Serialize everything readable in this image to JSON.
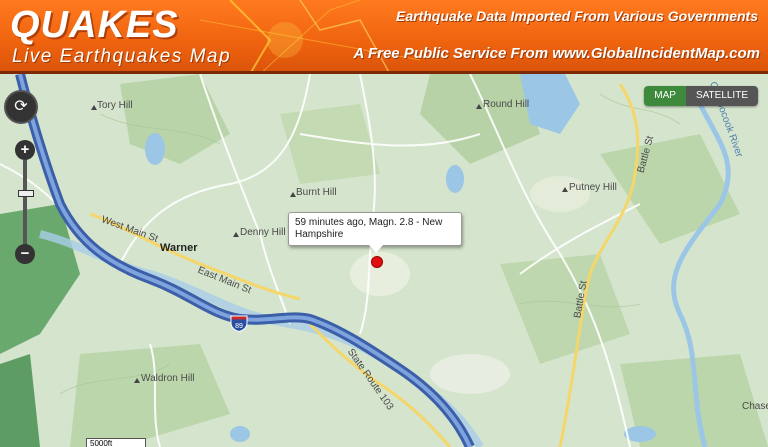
{
  "header": {
    "brand": "QUAKES",
    "subbrand": "Live Earthquakes Map",
    "tagline_top": "Earthquake Data Imported From Various Governments",
    "tagline_bottom": "A Free Public Service From www.GlobalIncidentMap.com"
  },
  "map_toggle": {
    "map_label": "MAP",
    "satellite_label": "SATELLITE",
    "active": "MAP"
  },
  "nav": {
    "zoom_in": "+",
    "zoom_out": "−",
    "pan_symbol": "⟳",
    "north_label": "N"
  },
  "popup": {
    "text": "59 minutes ago, Magn. 2.8 - New Hampshire"
  },
  "labels": {
    "tory_hill": "Tory Hill",
    "round_hill": "Round Hill",
    "burnt_hill": "Burnt Hill",
    "denny_hill": "Denny Hill",
    "warner": "Warner",
    "west_main_st": "West Main St",
    "east_main_st": "East Main St",
    "putney_hill": "Putney Hill",
    "waldron_hill": "Waldron Hill",
    "state_route": "State Route 103",
    "battle_st_upper": "Battle St",
    "battle_st_lower": "Battle St",
    "contoocook_river": "Contoocook River",
    "chase": "Chase",
    "interstate": "89",
    "scale": "5000ft"
  },
  "colors": {
    "header_orange": "#f0640f",
    "quake_marker": "#e01010",
    "highway": "#4a6fb5",
    "map_active": "#3d8a3d"
  }
}
